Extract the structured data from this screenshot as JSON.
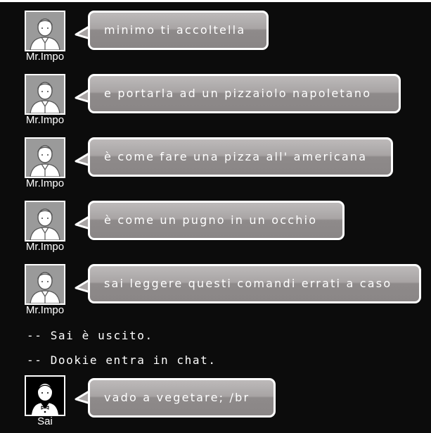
{
  "messages": [
    {
      "user": "Mr.Impo",
      "avatar": "mr-impo-avatar-icon",
      "text": "minimo ti accoltella"
    },
    {
      "user": "Mr.Impo",
      "avatar": "mr-impo-avatar-icon",
      "text": "e portarla ad un pizzaiolo napoletano"
    },
    {
      "user": "Mr.Impo",
      "avatar": "mr-impo-avatar-icon",
      "text": "è come fare una pizza all' americana"
    },
    {
      "user": "Mr.Impo",
      "avatar": "mr-impo-avatar-icon",
      "text": "è come un pugno in un occhio"
    },
    {
      "user": "Mr.Impo",
      "avatar": "mr-impo-avatar-icon",
      "text": "sai leggere questi comandi errati a caso"
    }
  ],
  "system_messages": [
    "-- Sai è uscito.",
    "-- Dookie entra in chat."
  ],
  "last_message": {
    "user": "Sai",
    "avatar": "sai-avatar-icon",
    "text": "vado a vegetare; /br"
  },
  "colors": {
    "background": "#0c0c0c",
    "bubble_top": "#bdbaba",
    "bubble_bottom": "#8a8686",
    "border": "#ffffff"
  }
}
